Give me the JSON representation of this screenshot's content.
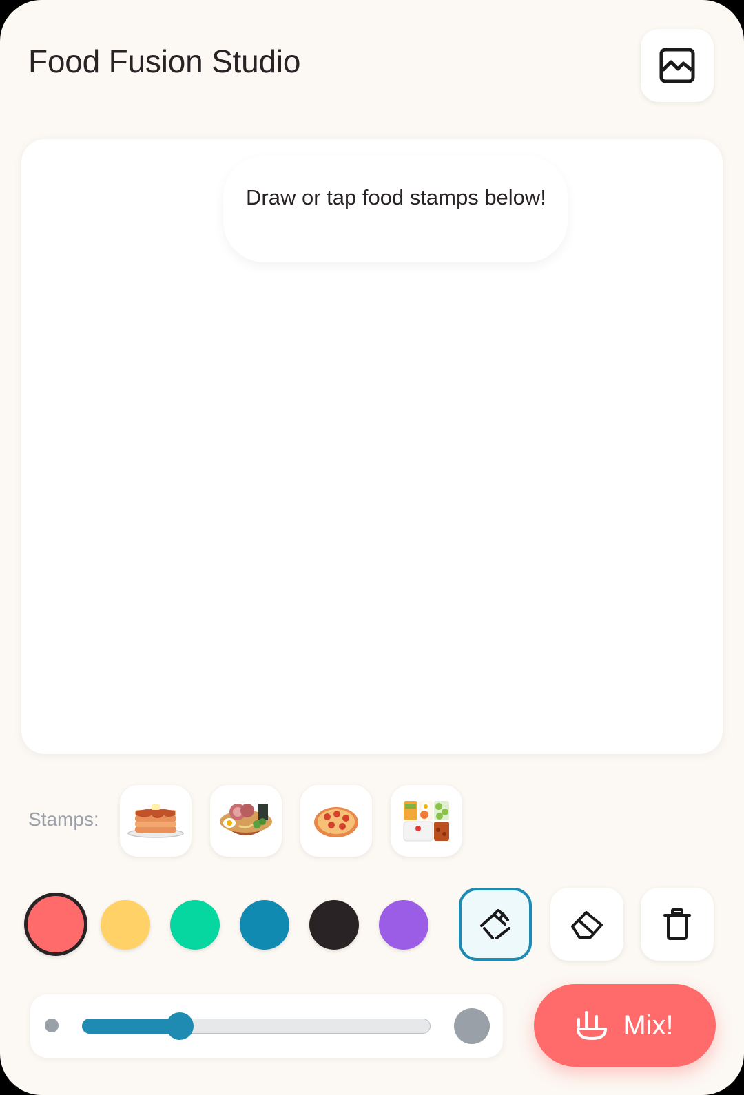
{
  "header": {
    "title": "Food Fusion Studio",
    "gallery_icon": "image-icon"
  },
  "canvas": {
    "hint": "Draw or tap food stamps below!"
  },
  "stamps": {
    "label": "Stamps:",
    "items": [
      {
        "name": "pancakes",
        "icon": "pancakes-icon"
      },
      {
        "name": "ramen",
        "icon": "ramen-icon"
      },
      {
        "name": "pizza",
        "icon": "pizza-icon"
      },
      {
        "name": "bento",
        "icon": "bento-icon"
      }
    ]
  },
  "colors": {
    "selected": "#ff6b6b",
    "palette": [
      "#ff6b6b",
      "#ffd166",
      "#06d6a0",
      "#118ab2",
      "#2a2326",
      "#9b5de5"
    ]
  },
  "tools": {
    "active": "brush",
    "items": [
      {
        "name": "brush",
        "icon": "brush-icon"
      },
      {
        "name": "eraser",
        "icon": "eraser-icon"
      },
      {
        "name": "clear",
        "icon": "trash-icon"
      }
    ]
  },
  "brush_size": {
    "value_fraction": 0.28
  },
  "mix_button": {
    "label": "Mix!",
    "icon": "mixer-icon"
  },
  "accent_color": "#1f8bb3"
}
